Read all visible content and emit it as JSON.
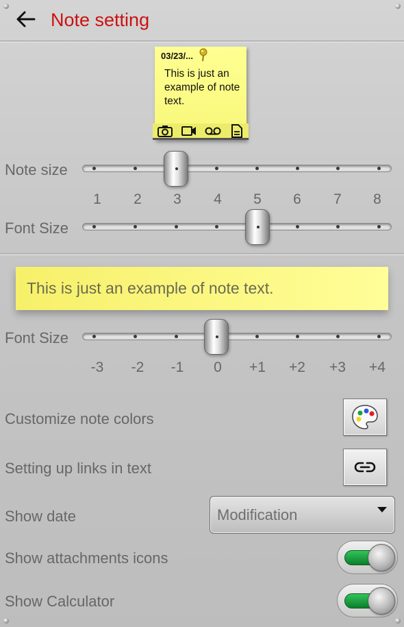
{
  "header": {
    "title": "Note setting"
  },
  "sticky_note": {
    "date": "03/23/...",
    "text": "This is just an example of note text.",
    "attachment_icons": [
      "camera-icon",
      "video-icon",
      "voicemail-icon",
      "document-icon"
    ],
    "color": "#ffff92"
  },
  "note_size": {
    "label": "Note size",
    "ticks": [
      "1",
      "2",
      "3",
      "4",
      "5",
      "6",
      "7",
      "8"
    ],
    "value": "3"
  },
  "sticky_font_size": {
    "label": "Font Size",
    "value": "5"
  },
  "banner": {
    "text": "This is just an example of note text.",
    "color": "#f7f06a"
  },
  "banner_font_size": {
    "label": "Font Size",
    "ticks": [
      "-3",
      "-2",
      "-1",
      "0",
      "+1",
      "+2",
      "+3",
      "+4"
    ],
    "value": "0"
  },
  "options": {
    "customize_colors": {
      "label": "Customize note colors",
      "icon": "palette-icon"
    },
    "links": {
      "label": "Setting up links in text",
      "icon": "link-icon"
    },
    "show_date": {
      "label": "Show date",
      "selected": "Modification"
    },
    "show_attachments": {
      "label": "Show attachments icons",
      "on": true
    },
    "show_calculator": {
      "label": "Show Calculator",
      "on": true
    }
  },
  "colors": {
    "title": "#cc1111",
    "toggle_on": "#1a9e3e"
  }
}
